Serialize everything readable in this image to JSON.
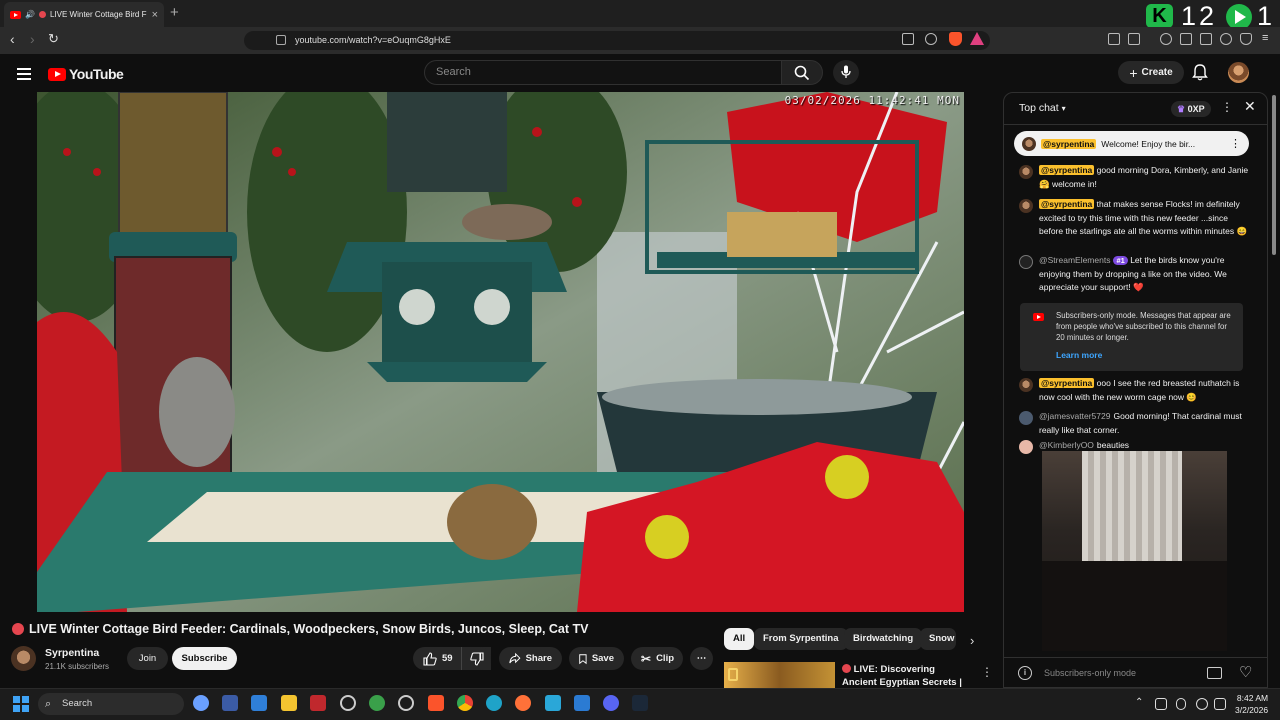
{
  "browser": {
    "tab_title": "LIVE Winter Cottage Bird F",
    "url": "youtube.com/watch?v=eOuqmG8gHxE",
    "overlay_number": "12",
    "overlay_number_2": "1"
  },
  "header": {
    "logo_text": "YouTube",
    "search_placeholder": "Search",
    "create_label": "Create"
  },
  "video": {
    "timestamp": "03/02/2026 11:42:41 MON",
    "title": "LIVE Winter Cottage Bird Feeder: Cardinals, Woodpeckers, Snow Birds, Juncos, Sleep, Cat TV"
  },
  "channel": {
    "name": "Syrpentina",
    "subscribers": "21.1K subscribers",
    "join_label": "Join",
    "subscribe_label": "Subscribe"
  },
  "actions": {
    "likes": "59",
    "share": "Share",
    "save": "Save",
    "clip": "Clip"
  },
  "chips": [
    "All",
    "From Syrpentina",
    "Birdwatching",
    "Snow"
  ],
  "recommendation": {
    "title": "LIVE: Discovering Ancient Egyptian Secrets | Lost ..."
  },
  "chat": {
    "mode": "Top chat",
    "points": "0XP",
    "pinned_mention": "@syrpentina",
    "pinned_text": "Welcome! Enjoy the bir...",
    "messages": [
      {
        "mention": "@syrpentina",
        "text": "good morning Dora, Kimberly, and Janie 🤗 welcome in!"
      },
      {
        "mention": "@syrpentina",
        "text": "that makes sense Flocks! im definitely excited to try this time with this new feeder ...since before the starlings ate all the worms within minutes 😄"
      },
      {
        "author": "@StreamElements",
        "rank": "#1",
        "text": "Let the birds know you're enjoying them by dropping a like on the video. We appreciate your support! ❤️"
      },
      {
        "mention": "@syrpentina",
        "text": "ooo I see the red breasted nuthatch is now cool with the new worm cage now 😊"
      },
      {
        "author": "@jamesvatter5729",
        "text": "Good morning! That cardinal must really like that corner."
      },
      {
        "author": "@KimberlyOO",
        "text": "beauties"
      }
    ],
    "notice_text": "Subscribers-only mode. Messages that appear are from people who've subscribed to this channel for 20 minutes or longer.",
    "learn_more": "Learn more",
    "input_placeholder": "Subscribers-only mode"
  },
  "taskbar": {
    "search": "Search",
    "time": "8:42 AM",
    "date": "3/2/2026"
  },
  "colors": {
    "brand_red": "#ff0000",
    "mention_bg": "#fbc02d",
    "link_blue": "#3ea6ff",
    "overlay_green": "#20b84a"
  }
}
